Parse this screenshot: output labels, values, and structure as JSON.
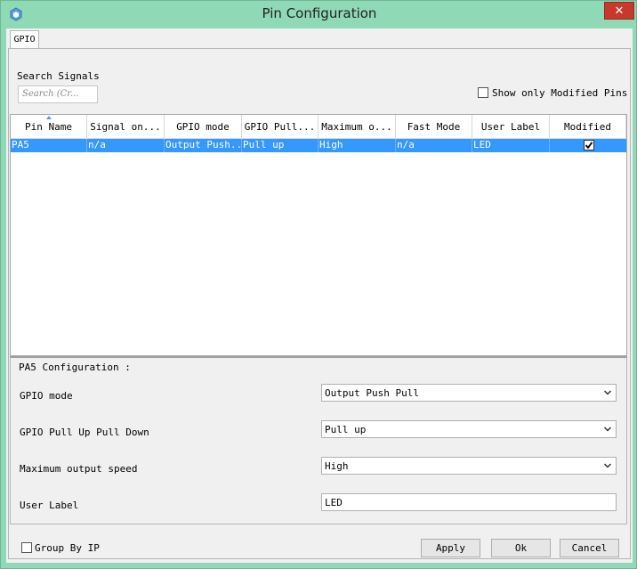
{
  "window": {
    "title": "Pin Configuration",
    "close_label": "✕"
  },
  "tabs": [
    {
      "label": "GPIO"
    }
  ],
  "search": {
    "label": "Search Signals",
    "placeholder": "Search (Cr..."
  },
  "filter": {
    "show_modified_label": "Show only Modified Pins",
    "checked": false
  },
  "table": {
    "columns": [
      "Pin Name",
      "Signal on...",
      "GPIO mode",
      "GPIO Pull...",
      "Maximum o...",
      "Fast Mode",
      "User Label",
      "Modified"
    ],
    "rows": [
      {
        "pin": "PA5",
        "signal": "n/a",
        "mode": "Output Push...",
        "pull": "Pull up",
        "speed": "High",
        "fast": "n/a",
        "label": "LED",
        "modified": true
      }
    ]
  },
  "config": {
    "title": "PA5 Configuration :",
    "gpio_mode": {
      "label": "GPIO mode",
      "value": "Output Push Pull"
    },
    "pull": {
      "label": "GPIO Pull Up Pull Down",
      "value": "Pull up"
    },
    "speed": {
      "label": "Maximum output speed",
      "value": "High"
    },
    "user_label": {
      "label": "User Label",
      "value": "LED"
    }
  },
  "footer": {
    "group_by_label": "Group By IP",
    "group_by_checked": false,
    "apply": "Apply",
    "ok": "Ok",
    "cancel": "Cancel"
  },
  "colors": {
    "selection": "#3399ff",
    "close": "#c7382d",
    "frame": "#8fd9b6"
  }
}
